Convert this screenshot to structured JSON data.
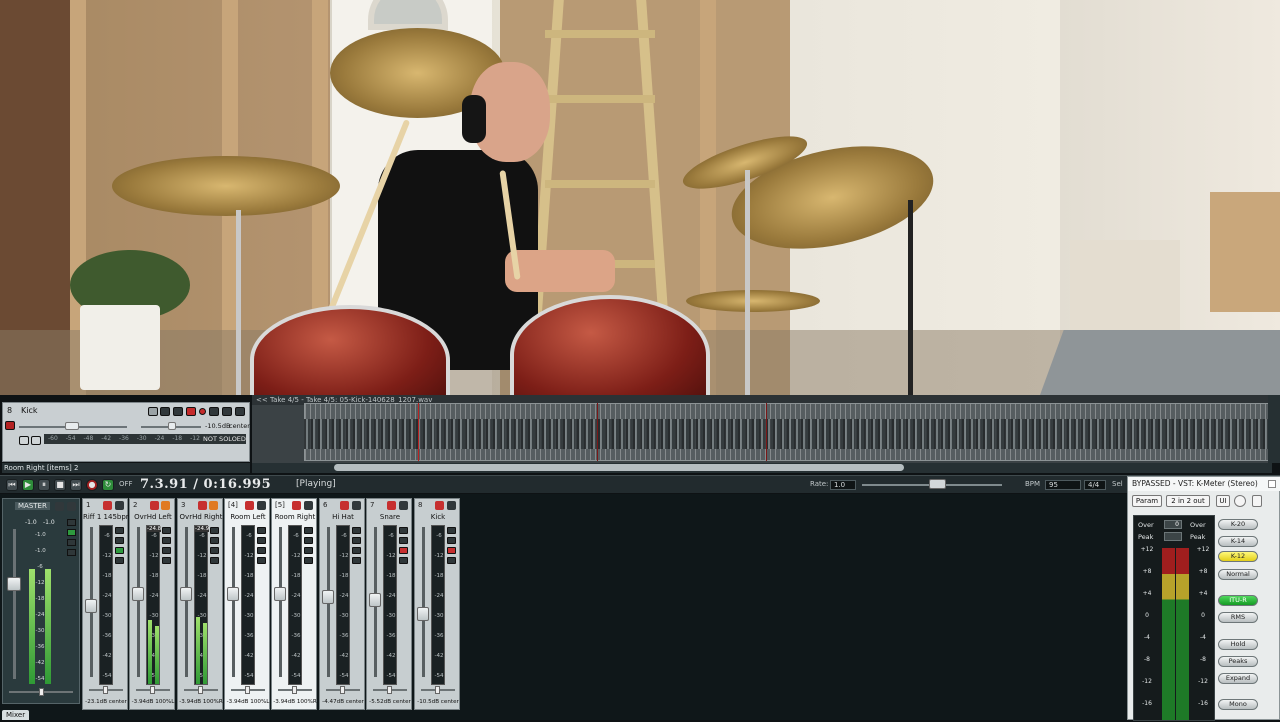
{
  "video": {
    "description_visible": true
  },
  "track_panel": {
    "number": "8",
    "name": "Kick",
    "vol_text": "-10.5dB",
    "pan_text": "center",
    "solo_state": "NOT SOLOED",
    "scale": [
      "-60",
      "-54",
      "-48",
      "-42",
      "-36",
      "-30",
      "-24",
      "-18",
      "-12"
    ]
  },
  "arrange": {
    "take_label": "<< Take 4/5 - Take 4/5: 05-Kick-140628_1207.wav"
  },
  "item_status": "Room Right [items] 2",
  "transport": {
    "time": "7.3.91 / 0:16.995",
    "state": "[Playing]",
    "off_label": "OFF",
    "rate_label": "Rate:",
    "rate_value": "1.0",
    "bpm_label": "BPM",
    "bpm_value": "95",
    "sig_value": "4/4",
    "sel_label": "Sel"
  },
  "mixer": {
    "tab_label": "Mixer",
    "master": {
      "label": "MASTER",
      "scale": [
        "-1.0",
        "-1.0",
        "-6",
        "-12",
        "-18",
        "-24",
        "-30",
        "-36",
        "-42",
        "-54"
      ],
      "peak_left": "-1.0",
      "peak_right": "-1.0"
    },
    "strips": [
      {
        "num": "1",
        "name": "Riff 1 145bpm",
        "db": "-23.1dB center",
        "peak": "",
        "fader": 0.52,
        "level": 0.0,
        "selected": false
      },
      {
        "num": "2",
        "name": "OvrHd Left",
        "db": "-3.94dB 100%L",
        "peak": "-24.8",
        "fader": 0.6,
        "level": 0.4,
        "selected": false
      },
      {
        "num": "3",
        "name": "OvrHd Right",
        "db": "-3.94dB 100%R",
        "peak": "-24.9",
        "fader": 0.6,
        "level": 0.42,
        "selected": false
      },
      {
        "num": "[4]",
        "name": "Room Left",
        "db": "-3.94dB 100%L",
        "peak": "",
        "fader": 0.6,
        "level": 0.0,
        "selected": true
      },
      {
        "num": "[5]",
        "name": "Room Right",
        "db": "-3.94dB 100%R",
        "peak": "",
        "fader": 0.6,
        "level": 0.0,
        "selected": true
      },
      {
        "num": "6",
        "name": "Hi Hat",
        "db": "-4.47dB center",
        "peak": "",
        "fader": 0.58,
        "level": 0.0,
        "selected": false
      },
      {
        "num": "7",
        "name": "Snare",
        "db": "-5.52dB center",
        "peak": "",
        "fader": 0.56,
        "level": 0.0,
        "selected": false
      },
      {
        "num": "8",
        "name": "Kick",
        "db": "-10.5dB center",
        "peak": "",
        "fader": 0.47,
        "level": 0.0,
        "selected": false
      }
    ],
    "strip_scale": [
      "-6",
      "-12",
      "-18",
      "-24",
      "-30",
      "-36",
      "-42",
      "-54"
    ]
  },
  "vst": {
    "title": "BYPASSED - VST: K-Meter (Stereo)",
    "param_label": "Param",
    "io_label": "2 in 2 out",
    "ui_label": "UI",
    "over_label": "Over",
    "peak_label": "Peak",
    "over_value": "0",
    "scale": [
      "+12",
      "+8",
      "+4",
      "0",
      "-4",
      "-8",
      "-12",
      "-16"
    ],
    "buttons": [
      "K-20",
      "K-14",
      "K-12",
      "Normal",
      "ITU-R",
      "RMS",
      "Hold",
      "Peaks",
      "Expand",
      "Mono"
    ],
    "active_button": "K-12",
    "green_button": "ITU-R"
  },
  "colors": {
    "accent_red": "#c62f2f",
    "accent_green": "#2e9a3e",
    "accent_yellow": "#e3cf19"
  }
}
